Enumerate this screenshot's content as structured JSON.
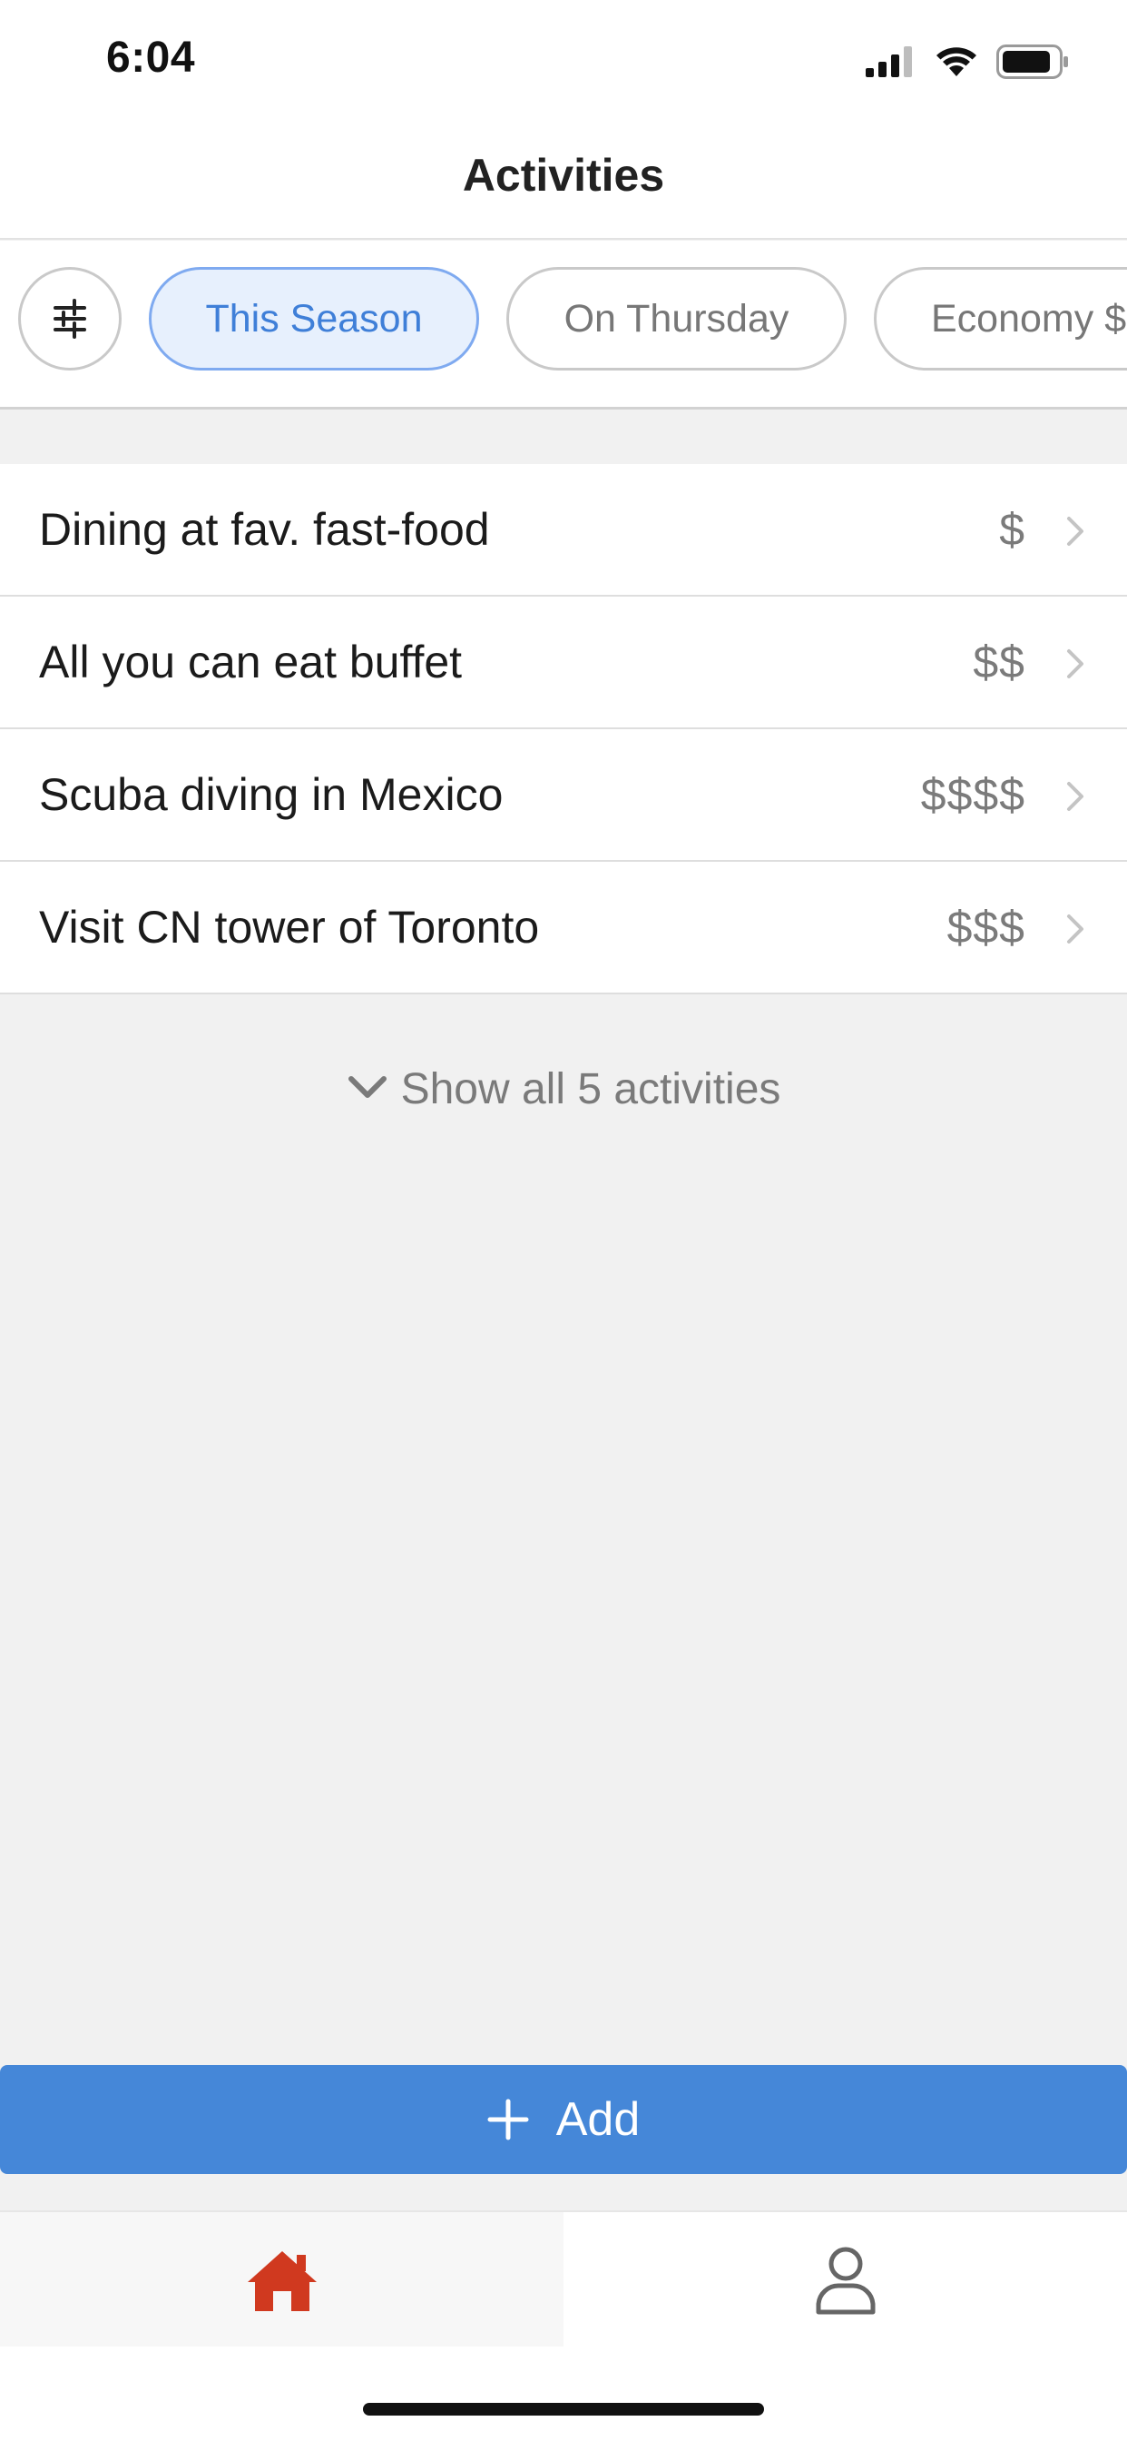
{
  "status_bar": {
    "time": "6:04",
    "icons": [
      "signal-icon",
      "wifi-icon",
      "battery-icon"
    ]
  },
  "header": {
    "title": "Activities"
  },
  "filters": {
    "settings_icon": "sliders-icon",
    "chips": [
      {
        "label": "This Season",
        "active": true
      },
      {
        "label": "On Thursday",
        "active": false
      },
      {
        "label": "Economy $",
        "active": false
      }
    ]
  },
  "activities": [
    {
      "title": "Dining at fav. fast-food",
      "price": "$"
    },
    {
      "title": "All you can eat buffet",
      "price": "$$"
    },
    {
      "title": "Scuba diving in Mexico",
      "price": "$$$$"
    },
    {
      "title": "Visit CN tower of Toronto",
      "price": "$$$"
    }
  ],
  "show_all": {
    "label": "Show all 5 activities",
    "icon": "chevron-down-icon"
  },
  "add_button": {
    "label": "Add",
    "icon": "plus-icon"
  },
  "tab_bar": {
    "tabs": [
      {
        "name": "home",
        "icon": "home-icon",
        "active": true
      },
      {
        "name": "profile",
        "icon": "user-icon",
        "active": false
      }
    ]
  },
  "colors": {
    "accent": "#4587d8",
    "active_chip_text": "#3f7fd8",
    "active_chip_bg": "#e7f0fd",
    "home_icon": "#d0391f",
    "background": "#f1f1f1"
  }
}
